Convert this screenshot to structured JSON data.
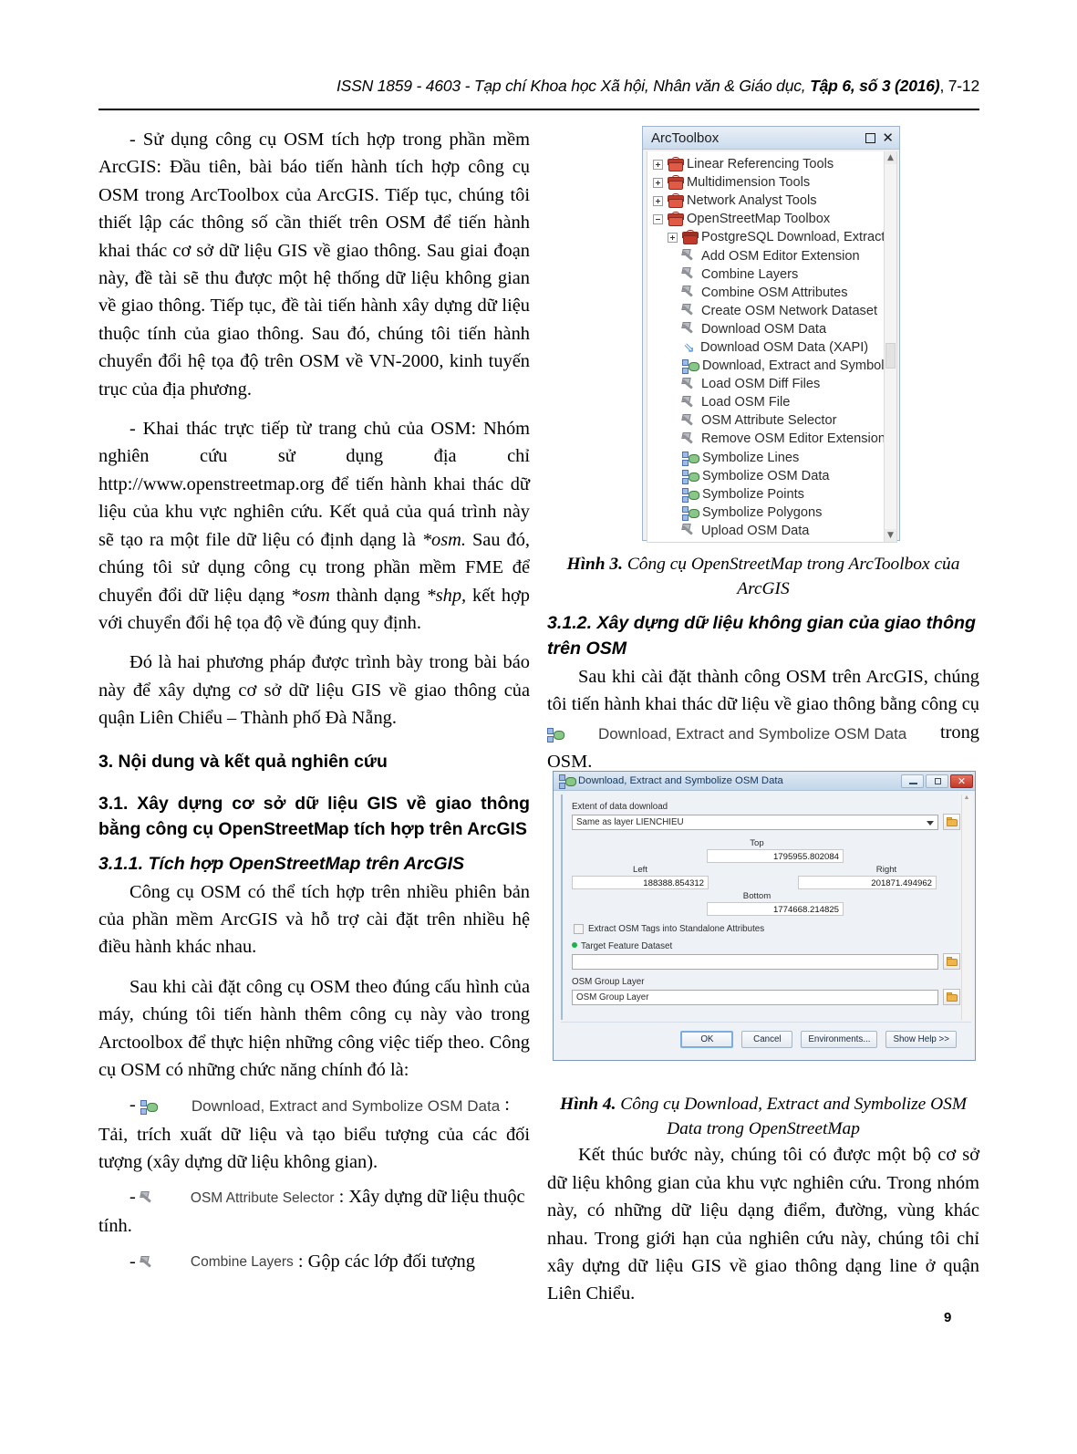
{
  "running_head": {
    "main": "ISSN 1859 - 4603 - Tạp chí Khoa học Xã hội, Nhân văn & Giáo dục,",
    "emphasis": "Tập 6, số 3 (2016)",
    "pages": ", 7-12"
  },
  "page_number": "9",
  "left_column": {
    "para1": "- Sử dụng công cụ OSM tích hợp trong phần mềm ArcGIS: Đầu tiên, bài báo tiến hành tích hợp công cụ OSM trong ArcToolbox của ArcGIS. Tiếp tục, chúng tôi thiết lập các thông số cần thiết trên OSM để tiến hành khai thác cơ sở dữ liệu GIS về giao thông. Sau giai đoạn này, đề tài sẽ thu được một hệ thống dữ liệu không gian về giao thông. Tiếp tục, đề tài tiến hành xây dựng dữ liệu thuộc tính của giao thông. Sau đó, chúng tôi tiến hành chuyển đổi hệ tọa độ trên OSM về VN-2000, kinh tuyến trục của địa phương.",
    "para2_a": "- Khai thác trực tiếp từ trang chủ của OSM: Nhóm nghiên cứu sử dụng địa chỉ http://www.openstreetmap.org để tiến hành khai thác dữ liệu của khu vực nghiên cứu. Kết quả của quá trình này sẽ tạo ra một file dữ liệu có định dạng là ",
    "para2_i1": "*osm.",
    "para2_b": " Sau đó, chúng tôi sử dụng công cụ trong phần mềm FME để chuyển đổi dữ liệu dạng ",
    "para2_i2": "*osm",
    "para2_c": " thành dạng ",
    "para2_i3": "*shp,",
    "para2_d": " kết hợp với chuyển đổi hệ tọa độ về đúng quy định.",
    "para3": "Đó là hai phương pháp được trình bày trong bài báo này để xây dựng cơ sở dữ liệu GIS về giao thông của quận Liên Chiểu – Thành phố Đà Nẵng.",
    "heading3": "3. Nội dung và kết quả nghiên cứu",
    "heading31": "3.1. Xây dựng cơ sở dữ liệu GIS về giao thông bằng công cụ OpenStreetMap tích hợp trên ArcGIS",
    "heading311": "3.1.1. Tích hợp OpenStreetMap trên ArcGIS",
    "para4": "Công cụ OSM có thể tích hợp trên nhiều phiên bản của phần mềm ArcGIS và hỗ trợ cài đặt trên nhiều hệ điều hành khác nhau.",
    "para5": "Sau khi cài đặt công cụ OSM theo đúng cấu hình của máy, chúng tôi tiến hành thêm công cụ này vào trong Arctoolbox để thực hiện những công việc tiếp theo. Công cụ OSM có những chức năng chính đó là:",
    "bullet1_dash": "-",
    "bullet1_tool": "Download, Extract and Symbolize OSM Data",
    "bullet1_colon": ":",
    "bullet1_text": "Tải, trích xuất dữ liệu và tạo biểu tượng của các đối tượng (xây dựng dữ liệu không gian).",
    "bullet2_dash": "-",
    "bullet2_tool": "OSM Attribute Selector",
    "bullet2_text": ": Xây dựng dữ liệu thuộc tính.",
    "bullet3_dash": "-",
    "bullet3_tool": "Combine Layers",
    "bullet3_text": ": Gộp các lớp đối tượng"
  },
  "right_column": {
    "caption3_label": "Hình 3.",
    "caption3_text": " Công cụ OpenStreetMap trong ArcToolbox của ArcGIS",
    "heading312": "3.1.2. Xây dựng dữ liệu không gian của giao thông trên OSM",
    "para1_a": "Sau khi cài đặt thành công OSM trên ArcGIS, chúng tôi tiến hành khai thác dữ liệu về giao thông bằng công cụ ",
    "para1_tool": "Download, Extract and Symbolize OSM Data",
    "para1_b": " trong OSM.",
    "caption4_label": "Hình 4.",
    "caption4_text": " Công cụ Download, Extract and Symbolize OSM Data trong OpenStreetMap",
    "para2": "Kết thúc bước này, chúng tôi có được một bộ cơ sở dữ liệu không gian của khu vực nghiên cứu. Trong nhóm này, có những dữ liệu dạng điểm, đường, vùng khác nhau. Trong giới hạn của nghiên cứu này, chúng tôi chỉ xây dựng dữ liệu GIS về giao thông dạng line ở quận Liên Chiểu."
  },
  "arctoolbox_window": {
    "title": "ArcToolbox",
    "maximize_icon": "maximize-icon",
    "close_icon": "close-icon",
    "tree": [
      {
        "label": "Linear Referencing Tools",
        "icon": "toolbox-icon",
        "indent": 1,
        "expander": "plus"
      },
      {
        "label": "Multidimension Tools",
        "icon": "toolbox-icon",
        "indent": 1,
        "expander": "plus"
      },
      {
        "label": "Network Analyst Tools",
        "icon": "toolbox-icon",
        "indent": 1,
        "expander": "plus"
      },
      {
        "label": "OpenStreetMap Toolbox",
        "icon": "toolbox-icon",
        "indent": 1,
        "expander": "minus"
      },
      {
        "label": "PostgreSQL Download, Extract ..",
        "icon": "toolset-icon",
        "indent": 2,
        "expander": "plus"
      },
      {
        "label": "Add OSM Editor Extension",
        "icon": "tool-icon",
        "indent": 2,
        "expander": "none"
      },
      {
        "label": "Combine Layers",
        "icon": "tool-icon",
        "indent": 2,
        "expander": "none"
      },
      {
        "label": "Combine OSM Attributes",
        "icon": "tool-icon",
        "indent": 2,
        "expander": "none"
      },
      {
        "label": "Create OSM Network Dataset",
        "icon": "tool-icon",
        "indent": 2,
        "expander": "none"
      },
      {
        "label": "Download OSM Data",
        "icon": "tool-icon",
        "indent": 2,
        "expander": "none"
      },
      {
        "label": "Download OSM Data (XAPI)",
        "icon": "xapi-icon",
        "indent": 2,
        "expander": "none"
      },
      {
        "label": "Download, Extract and Symboli",
        "icon": "model-icon",
        "indent": 2,
        "expander": "none"
      },
      {
        "label": "Load OSM Diff Files",
        "icon": "tool-icon",
        "indent": 2,
        "expander": "none"
      },
      {
        "label": "Load OSM File",
        "icon": "tool-icon",
        "indent": 2,
        "expander": "none"
      },
      {
        "label": "OSM Attribute Selector",
        "icon": "tool-icon",
        "indent": 2,
        "expander": "none"
      },
      {
        "label": "Remove OSM Editor Extension",
        "icon": "tool-icon",
        "indent": 2,
        "expander": "none"
      },
      {
        "label": "Symbolize Lines",
        "icon": "model-icon",
        "indent": 2,
        "expander": "none"
      },
      {
        "label": "Symbolize OSM Data",
        "icon": "model-icon",
        "indent": 2,
        "expander": "none"
      },
      {
        "label": "Symbolize Points",
        "icon": "model-icon",
        "indent": 2,
        "expander": "none"
      },
      {
        "label": "Symbolize Polygons",
        "icon": "model-icon",
        "indent": 2,
        "expander": "none"
      },
      {
        "label": "Upload OSM Data",
        "icon": "tool-icon",
        "indent": 2,
        "expander": "none"
      }
    ]
  },
  "download_dialog": {
    "title": "Download, Extract and Symbolize OSM Data",
    "extent_label": "Extent of data download",
    "extent_value": "Same as layer LIENCHIEU",
    "top_label": "Top",
    "top_value": "1795955.802084",
    "left_label": "Left",
    "left_value": "188388.854312",
    "right_label": "Right",
    "right_value": "201871.494962",
    "bottom_label": "Bottom",
    "bottom_value": "1774668.214825",
    "checkbox_label": "Extract OSM Tags into Standalone Attributes",
    "target_label": "Target Feature Dataset",
    "target_value": "",
    "group_label": "OSM Group Layer",
    "group_value": "OSM Group Layer",
    "btn_ok": "OK",
    "btn_cancel": "Cancel",
    "btn_environments": "Environments...",
    "btn_help": "Show Help >>"
  },
  "colors": {
    "title_bar_start": "#e9eff7",
    "title_bar_end": "#ccdcee",
    "toolbox_red": "#c0392b",
    "close_red": "#c0392b",
    "green_dot": "#1db24a"
  }
}
